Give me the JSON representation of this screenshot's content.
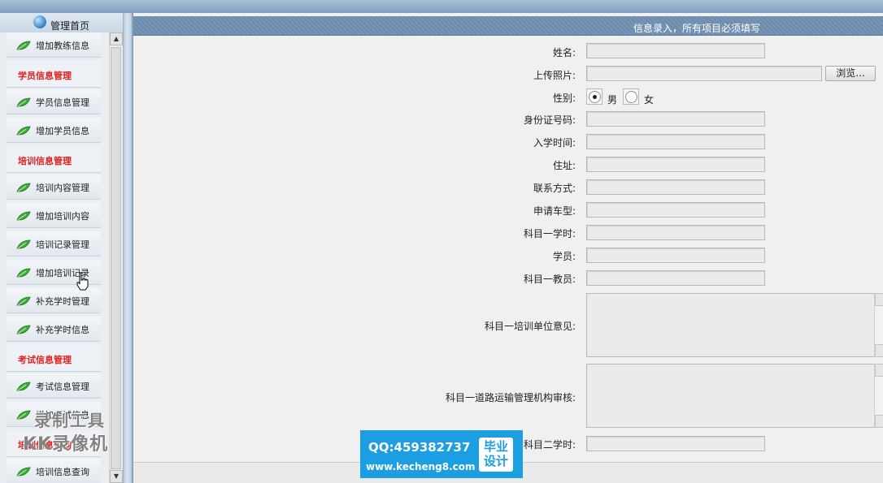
{
  "sidebar": {
    "home_label": "管理首页",
    "items": [
      {
        "type": "item",
        "label": "增加教练信息"
      },
      {
        "type": "group",
        "label": "学员信息管理"
      },
      {
        "type": "item",
        "label": "学员信息管理"
      },
      {
        "type": "item",
        "label": "增加学员信息"
      },
      {
        "type": "group",
        "label": "培训信息管理"
      },
      {
        "type": "item",
        "label": "培训内容管理"
      },
      {
        "type": "item",
        "label": "增加培训内容"
      },
      {
        "type": "item",
        "label": "培训记录管理"
      },
      {
        "type": "item",
        "label": "增加培训记录"
      },
      {
        "type": "item",
        "label": "补充学时管理"
      },
      {
        "type": "item",
        "label": "补充学时信息"
      },
      {
        "type": "group",
        "label": "考试信息管理"
      },
      {
        "type": "item",
        "label": "考试信息管理"
      },
      {
        "type": "item",
        "label": "增加考试信息"
      },
      {
        "type": "group",
        "label": "培训信息查询"
      },
      {
        "type": "item",
        "label": "培训信息查询"
      }
    ]
  },
  "form": {
    "header_title": "信息录入，所有项目必须填写",
    "fields": {
      "name": "姓名:",
      "photo": "上传照片:",
      "gender": "性别:",
      "id_number": "身份证号码:",
      "enroll_time": "入学时间:",
      "address": "住址:",
      "contact": "联系方式:",
      "vehicle_type": "申请车型:",
      "subject1_hours": "科目一学时:",
      "student": "学员:",
      "subject1_coach": "科目一教员:",
      "subject1_unit_opinion": "科目一培训单位意见:",
      "subject1_road_review": "科目一道路运输管理机构审核:",
      "subject2_hours": "科目二学时:"
    },
    "browse_label": "浏览...",
    "gender_options": {
      "male": "男",
      "female": "女",
      "selected": "male"
    }
  },
  "watermark": {
    "line1": "录制工具",
    "line2": "KK录像机"
  },
  "banner": {
    "qq": "QQ:459382737",
    "url": "www.kecheng8.com",
    "badge_line1": "毕业",
    "badge_line2": "设计"
  },
  "colors": {
    "group_label": "#e02020",
    "header_bg": "#7897b6",
    "banner_bg": "#1c9ee2"
  },
  "icons": {
    "menu_item": "leaf-icon",
    "home": "globe-icon",
    "cursor": "hand-cursor-icon"
  }
}
